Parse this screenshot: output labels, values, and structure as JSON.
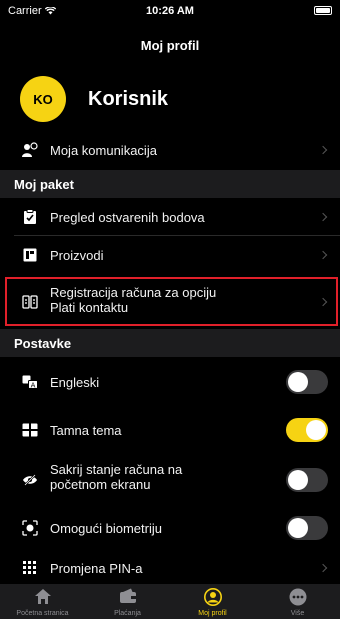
{
  "status_bar": {
    "carrier": "Carrier",
    "time": "10:26 AM"
  },
  "header": {
    "title": "Moj profil"
  },
  "profile": {
    "initials": "KO",
    "name": "Korisnik"
  },
  "rows": {
    "communication": "Moja komunikacija",
    "points": "Pregled ostvarenih bodova",
    "products": "Proizvodi",
    "registration_line1": "Registracija računa za opciju",
    "registration_line2": "Plati kontaktu",
    "english": "Engleski",
    "dark_theme": "Tamna tema",
    "hide_balance_line1": "Sakrij stanje računa na",
    "hide_balance_line2": "početnom ekranu",
    "biometrics": "Omogući biometriju",
    "pin": "Promjena PIN-a"
  },
  "sections": {
    "package": "Moj paket",
    "settings": "Postavke"
  },
  "toggles": {
    "english": false,
    "dark_theme": true,
    "hide_balance": false,
    "biometrics": false
  },
  "tabs": [
    {
      "label": "Početna stranica",
      "icon": "home-icon"
    },
    {
      "label": "Plaćanja",
      "icon": "wallet-icon"
    },
    {
      "label": "Moj profil",
      "icon": "profile-icon"
    },
    {
      "label": "Više",
      "icon": "more-icon"
    }
  ],
  "colors": {
    "accent": "#f6d313",
    "highlight_border": "#e1202a",
    "background": "#000000",
    "section_bg": "#1c1c1e"
  }
}
